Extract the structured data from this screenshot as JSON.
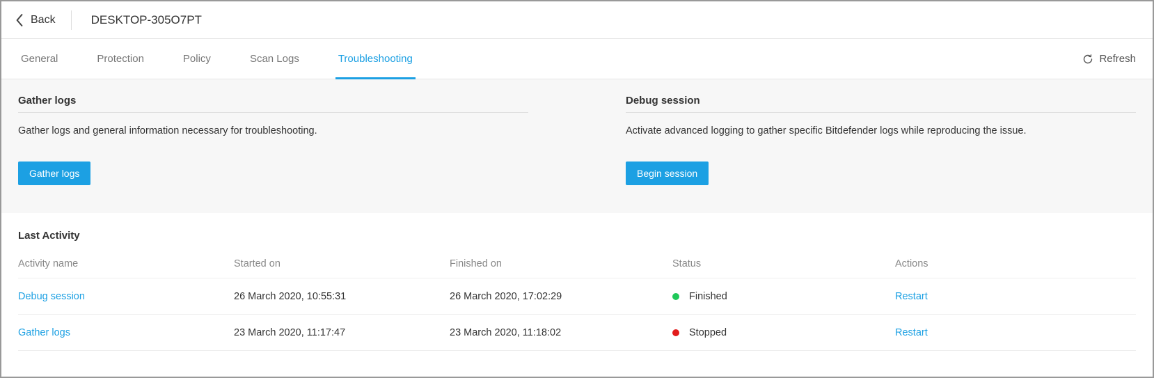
{
  "header": {
    "back_label": "Back",
    "device_name": "DESKTOP-305O7PT"
  },
  "tabs": {
    "general": "General",
    "protection": "Protection",
    "policy": "Policy",
    "scan_logs": "Scan Logs",
    "troubleshooting": "Troubleshooting",
    "active": "troubleshooting"
  },
  "refresh_label": "Refresh",
  "gather_panel": {
    "title": "Gather logs",
    "description": "Gather logs and general information necessary for troubleshooting.",
    "button": "Gather logs"
  },
  "debug_panel": {
    "title": "Debug session",
    "description": "Activate advanced logging to gather specific Bitdefender logs while reproducing the issue.",
    "button": "Begin session"
  },
  "activity": {
    "title": "Last Activity",
    "columns": {
      "name": "Activity name",
      "started": "Started on",
      "finished": "Finished on",
      "status": "Status",
      "actions": "Actions"
    },
    "rows": [
      {
        "name": "Debug session",
        "started": "26 March 2020, 10:55:31",
        "finished": "26 March 2020, 17:02:29",
        "status": "Finished",
        "status_color": "green",
        "action": "Restart"
      },
      {
        "name": "Gather logs",
        "started": "23 March 2020, 11:17:47",
        "finished": "23 March 2020, 11:18:02",
        "status": "Stopped",
        "status_color": "red",
        "action": "Restart"
      }
    ]
  }
}
